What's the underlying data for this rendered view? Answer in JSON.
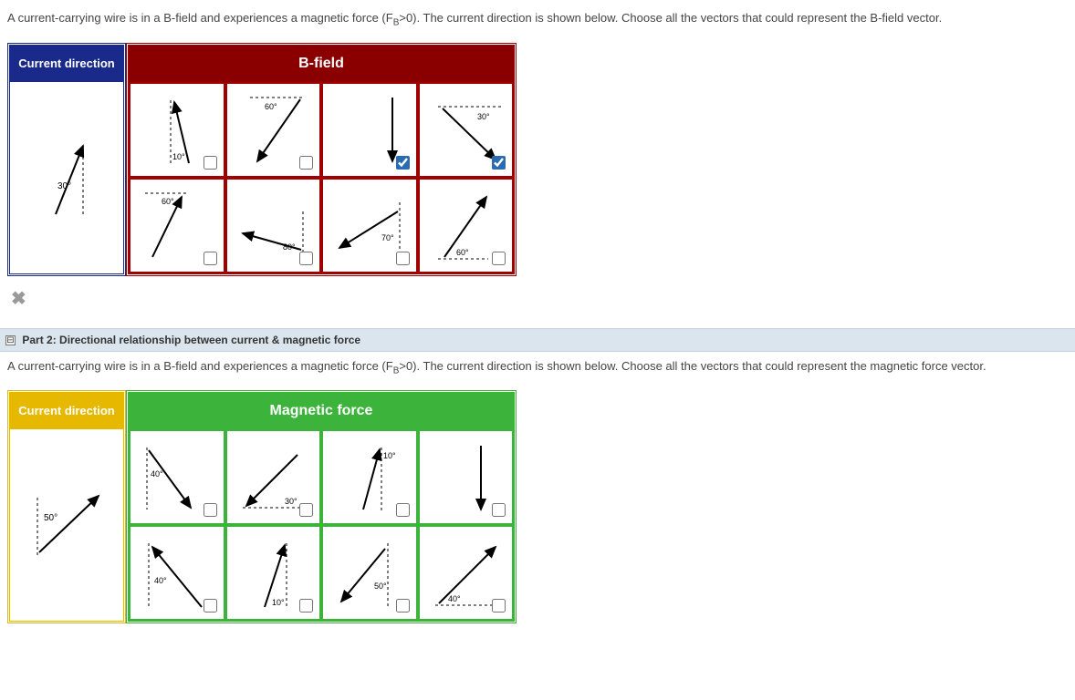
{
  "part1": {
    "question": "A current-carrying wire is in a B-field and experiences a magnetic force (F",
    "question_sub": "B",
    "question_after": ">0). The current direction is shown below. Choose all the vectors that could represent the B-field vector.",
    "ref_header": "Current direction",
    "ref_angle": "30°",
    "choice_header": "B-field",
    "options": [
      {
        "angle": "10°",
        "checked": false
      },
      {
        "angle": "60°",
        "checked": false
      },
      {
        "angle": "",
        "checked": true
      },
      {
        "angle": "30°",
        "checked": true
      },
      {
        "angle": "60°",
        "checked": false
      },
      {
        "angle": "80°",
        "checked": false
      },
      {
        "angle": "70°",
        "checked": false
      },
      {
        "angle": "60°",
        "checked": false
      }
    ],
    "result_symbol": "✖"
  },
  "part2": {
    "header_toggle": "⊟",
    "header_text": "Part 2: Directional relationship between current & magnetic force",
    "question": "A current-carrying wire is in a B-field and experiences a magnetic force (F",
    "question_sub": "B",
    "question_after": ">0). The current direction is shown below. Choose all the vectors that could represent the magnetic force vector.",
    "ref_header": "Current direction",
    "ref_angle": "50°",
    "choice_header": "Magnetic force",
    "options": [
      {
        "angle": "40°",
        "checked": false
      },
      {
        "angle": "30°",
        "checked": false
      },
      {
        "angle": "10°",
        "checked": false
      },
      {
        "angle": "",
        "checked": false
      },
      {
        "angle": "40°",
        "checked": false
      },
      {
        "angle": "10°",
        "checked": false
      },
      {
        "angle": "50°",
        "checked": false
      },
      {
        "angle": "40°",
        "checked": false
      }
    ]
  }
}
